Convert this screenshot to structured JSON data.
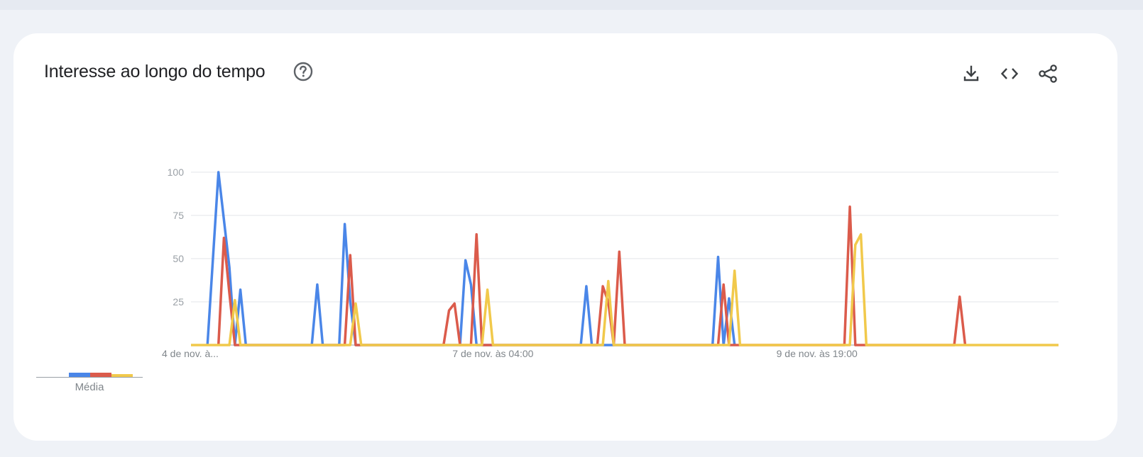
{
  "card": {
    "title": "Interesse ao longo do tempo",
    "icons": {
      "help": "help-circle-icon",
      "download": "download-icon",
      "embed": "code-embed-icon",
      "share": "share-icon"
    }
  },
  "average": {
    "label": "Média",
    "colors": [
      "#4a86e8",
      "#db5b4b",
      "#f1c94b"
    ],
    "values": [
      6,
      6,
      4
    ]
  },
  "chart_data": {
    "type": "line",
    "title": "",
    "xlabel": "",
    "ylabel": "",
    "ylim": [
      0,
      100
    ],
    "yticks": [
      25,
      50,
      75,
      100
    ],
    "grid": true,
    "x_tick_labels": [
      {
        "index": 0,
        "label": "4 de nov. à..."
      },
      {
        "index": 55,
        "label": "7 de nov. às 04:00"
      },
      {
        "index": 114,
        "label": "9 de nov. às 19:00"
      }
    ],
    "n_points": 159,
    "series": [
      {
        "color": "#4a86e8",
        "points": [
          [
            3,
            0
          ],
          [
            5,
            100
          ],
          [
            7,
            45
          ],
          [
            8,
            0
          ],
          [
            9,
            32
          ],
          [
            10,
            0
          ],
          [
            22,
            0
          ],
          [
            23,
            35
          ],
          [
            24,
            0
          ],
          [
            27,
            0
          ],
          [
            28,
            70
          ],
          [
            29,
            25
          ],
          [
            30,
            0
          ],
          [
            49,
            0
          ],
          [
            50,
            49
          ],
          [
            51,
            35
          ],
          [
            52,
            0
          ],
          [
            71,
            0
          ],
          [
            72,
            34
          ],
          [
            73,
            0
          ],
          [
            95,
            0
          ],
          [
            96,
            51
          ],
          [
            97,
            0
          ],
          [
            98,
            27
          ],
          [
            99,
            0
          ]
        ]
      },
      {
        "color": "#db5b4b",
        "points": [
          [
            5,
            0
          ],
          [
            6,
            62
          ],
          [
            7,
            30
          ],
          [
            8,
            0
          ],
          [
            28,
            0
          ],
          [
            29,
            52
          ],
          [
            30,
            0
          ],
          [
            46,
            0
          ],
          [
            47,
            20
          ],
          [
            48,
            24
          ],
          [
            49,
            0
          ],
          [
            51,
            0
          ],
          [
            52,
            64
          ],
          [
            53,
            0
          ],
          [
            74,
            0
          ],
          [
            75,
            34
          ],
          [
            76,
            25
          ],
          [
            77,
            0
          ],
          [
            78,
            54
          ],
          [
            79,
            0
          ],
          [
            96,
            0
          ],
          [
            97,
            35
          ],
          [
            98,
            0
          ],
          [
            119,
            0
          ],
          [
            120,
            80
          ],
          [
            121,
            0
          ],
          [
            139,
            0
          ],
          [
            140,
            28
          ],
          [
            141,
            0
          ]
        ]
      },
      {
        "color": "#f1c94b",
        "points": [
          [
            0,
            0
          ],
          [
            7,
            0
          ],
          [
            8,
            26
          ],
          [
            9,
            0
          ],
          [
            29,
            0
          ],
          [
            30,
            24
          ],
          [
            31,
            0
          ],
          [
            53,
            0
          ],
          [
            54,
            32
          ],
          [
            55,
            0
          ],
          [
            75,
            0
          ],
          [
            76,
            37
          ],
          [
            77,
            0
          ],
          [
            98,
            0
          ],
          [
            99,
            43
          ],
          [
            100,
            0
          ],
          [
            120,
            0
          ],
          [
            121,
            58
          ],
          [
            122,
            64
          ],
          [
            123,
            0
          ],
          [
            158,
            0
          ]
        ]
      }
    ]
  }
}
